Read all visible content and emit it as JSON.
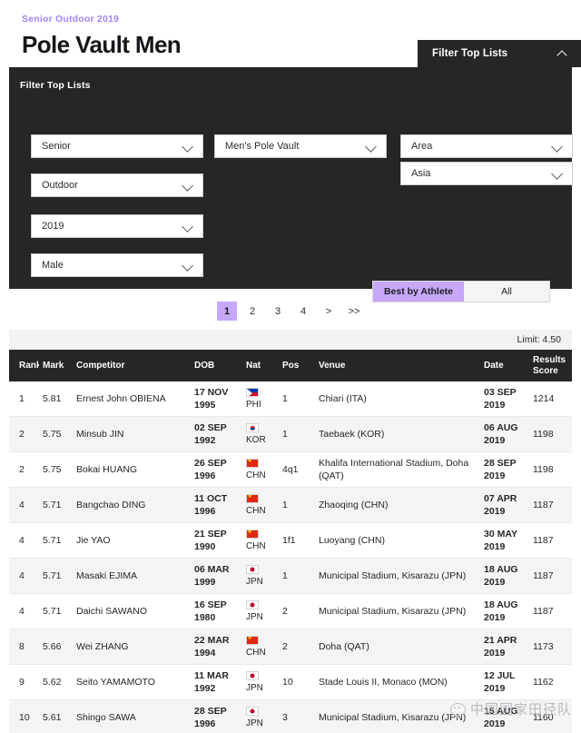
{
  "header": {
    "eyebrow": "Senior Outdoor 2019",
    "title": "Pole Vault Men"
  },
  "filter_tab": {
    "label": "Filter Top Lists",
    "chevron_icon": "chevron-up-icon"
  },
  "filter_panel": {
    "title": "Filter Top Lists",
    "selects": [
      {
        "name": "category",
        "value": "Senior"
      },
      {
        "name": "discipline",
        "value": "Men's Pole Vault"
      },
      {
        "name": "area",
        "value": "Area"
      },
      {
        "name": "environment",
        "value": "Outdoor"
      },
      {
        "name": "region",
        "value": "Asia"
      },
      {
        "name": "year",
        "value": "2019"
      },
      {
        "name": "gender",
        "value": "Male"
      }
    ],
    "toggle": {
      "best_by_athlete": "Best by Athlete",
      "all": "All",
      "active": "Best by Athlete"
    }
  },
  "pagination": {
    "pages": [
      "1",
      "2",
      "3",
      "4"
    ],
    "next": ">",
    "last": ">>",
    "active": "1"
  },
  "limit": "Limit: 4.50",
  "table": {
    "columns": [
      "Rank",
      "Mark",
      "Competitor",
      "DOB",
      "Nat",
      "Pos",
      "Venue",
      "Date",
      "Results Score"
    ],
    "rows": [
      {
        "rank": "1",
        "mark": "5.81",
        "competitor": "Ernest John OBIENA",
        "dob_day": "17 NOV",
        "dob_year": "1995",
        "flag": "phi",
        "nat": "PHI",
        "pos": "1",
        "venue": "Chiari (ITA)",
        "date_day": "03 SEP",
        "date_year": "2019",
        "score": "1214"
      },
      {
        "rank": "2",
        "mark": "5.75",
        "competitor": "Minsub JIN",
        "dob_day": "02 SEP",
        "dob_year": "1992",
        "flag": "kor",
        "nat": "KOR",
        "pos": "1",
        "venue": "Taebaek (KOR)",
        "date_day": "06 AUG",
        "date_year": "2019",
        "score": "1198"
      },
      {
        "rank": "2",
        "mark": "5.75",
        "competitor": "Bokai HUANG",
        "dob_day": "26 SEP",
        "dob_year": "1996",
        "flag": "chn",
        "nat": "CHN",
        "pos": "4q1",
        "venue": "Khalifa International Stadium, Doha (QAT)",
        "date_day": "28 SEP",
        "date_year": "2019",
        "score": "1198"
      },
      {
        "rank": "4",
        "mark": "5.71",
        "competitor": "Bangchao DING",
        "dob_day": "11 OCT",
        "dob_year": "1996",
        "flag": "chn",
        "nat": "CHN",
        "pos": "1",
        "venue": "Zhaoqing (CHN)",
        "date_day": "07 APR",
        "date_year": "2019",
        "score": "1187"
      },
      {
        "rank": "4",
        "mark": "5.71",
        "competitor": "Jie YAO",
        "dob_day": "21 SEP",
        "dob_year": "1990",
        "flag": "chn",
        "nat": "CHN",
        "pos": "1f1",
        "venue": "Luoyang (CHN)",
        "date_day": "30 MAY",
        "date_year": "2019",
        "score": "1187"
      },
      {
        "rank": "4",
        "mark": "5.71",
        "competitor": "Masaki EJIMA",
        "dob_day": "06 MAR",
        "dob_year": "1999",
        "flag": "jpn",
        "nat": "JPN",
        "pos": "1",
        "venue": "Municipal Stadium, Kisarazu (JPN)",
        "date_day": "18 AUG",
        "date_year": "2019",
        "score": "1187"
      },
      {
        "rank": "4",
        "mark": "5.71",
        "competitor": "Daichi SAWANO",
        "dob_day": "16 SEP",
        "dob_year": "1980",
        "flag": "jpn",
        "nat": "JPN",
        "pos": "2",
        "venue": "Municipal Stadium, Kisarazu (JPN)",
        "date_day": "18 AUG",
        "date_year": "2019",
        "score": "1187"
      },
      {
        "rank": "8",
        "mark": "5.66",
        "competitor": "Wei ZHANG",
        "dob_day": "22 MAR",
        "dob_year": "1994",
        "flag": "chn",
        "nat": "CHN",
        "pos": "2",
        "venue": "Doha (QAT)",
        "date_day": "21 APR",
        "date_year": "2019",
        "score": "1173"
      },
      {
        "rank": "9",
        "mark": "5.62",
        "competitor": "Seito YAMAMOTO",
        "dob_day": "11 MAR",
        "dob_year": "1992",
        "flag": "jpn",
        "nat": "JPN",
        "pos": "10",
        "venue": "Stade Louis II, Monaco (MON)",
        "date_day": "12 JUL",
        "date_year": "2019",
        "score": "1162"
      },
      {
        "rank": "10",
        "mark": "5.61",
        "competitor": "Shingo SAWA",
        "dob_day": "28 SEP",
        "dob_year": "1996",
        "flag": "jpn",
        "nat": "JPN",
        "pos": "3",
        "venue": "Municipal Stadium, Kisarazu (JPN)",
        "date_day": "15 AUG",
        "date_year": "2019",
        "score": "1160"
      }
    ]
  },
  "watermark": {
    "text": "中国国家田径队",
    "icon": "wechat-icon"
  },
  "colors": {
    "accent_purple": "#c6a7f8",
    "eyebrow_purple": "#a285f0",
    "dark_panel": "#262626",
    "alt_row": "#f4f4f5"
  }
}
